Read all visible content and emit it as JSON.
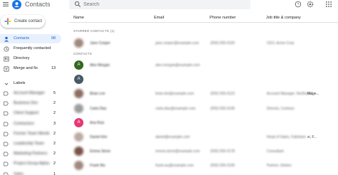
{
  "header": {
    "app_title": "Contacts",
    "search_placeholder": "Search",
    "icons": [
      "menu-icon",
      "contacts-logo-icon",
      "search-icon",
      "help-icon",
      "settings-icon",
      "apps-grid-icon"
    ]
  },
  "sidebar": {
    "create_label": "Create contact",
    "items": [
      {
        "label": "Contacts",
        "count": "98",
        "icon": "person-icon",
        "active": true
      },
      {
        "label": "Frequently contacted",
        "count": "",
        "icon": "history-icon",
        "active": false
      },
      {
        "label": "Directory",
        "count": "",
        "icon": "directory-icon",
        "active": false
      },
      {
        "label": "Merge and fix",
        "count": "13",
        "icon": "merge-icon",
        "active": false
      }
    ],
    "labels_title": "Labels",
    "labels": [
      {
        "name": "Account Manager",
        "count": "5"
      },
      {
        "name": "Business Dev",
        "count": "2"
      },
      {
        "name": "Client Support",
        "count": "2"
      },
      {
        "name": "Contractors",
        "count": "3"
      },
      {
        "name": "Former Team Members",
        "count": "2",
        "suffix": "...2"
      },
      {
        "name": "Leadership Team",
        "count": "2"
      },
      {
        "name": "Marketing Partners",
        "count": "2",
        "suffix": "..."
      },
      {
        "name": "Project Group Alpha",
        "count": "2"
      },
      {
        "name": "Sales",
        "count": "1"
      }
    ]
  },
  "main": {
    "columns": {
      "name": "Name",
      "email": "Email",
      "phone": "Phone number",
      "job": "Job title & company"
    },
    "starred_title": "STARRED CONTACTS (1)",
    "contacts_title": "CONTACTS",
    "starred": [
      {
        "avatar": "",
        "avatar_color": "#a1887f",
        "photo": true,
        "name": "Jane Cooper",
        "email": "jane.cooper@example.com",
        "phone": "(555) 555-0100",
        "job": "CEO, Acme Corp",
        "job_suffix": ""
      }
    ],
    "contacts": [
      {
        "avatar": "A",
        "avatar_color": "#33691e",
        "photo": false,
        "name": "Alex Morgan",
        "email": "alex.morgan@example.com",
        "phone": "",
        "job": "",
        "job_suffix": ""
      },
      {
        "avatar": "A",
        "avatar_color": "#455a64",
        "photo": false,
        "name": "",
        "email": "",
        "phone": "",
        "job": "",
        "job_suffix": ""
      },
      {
        "avatar": "",
        "avatar_color": "#8d6e63",
        "photo": true,
        "name": "Brian Lee",
        "email": "brian.lee@example.com",
        "phone": "(555) 555-0123",
        "job": "Account Manager, Northwind",
        "job_suffix": "Mage..."
      },
      {
        "avatar": "",
        "avatar_color": "#9e9e9e",
        "photo": true,
        "name": "Carla Diaz",
        "email": "carla.diaz@example.com",
        "phone": "(555) 555-0145",
        "job": "Director, Contoso",
        "job_suffix": ""
      },
      {
        "avatar": "A",
        "avatar_color": "#e53877",
        "photo": false,
        "name": "Ana Ruiz",
        "email": "",
        "phone": "",
        "job": "",
        "job_suffix": ""
      },
      {
        "avatar": "",
        "avatar_color": "#bcaaa4",
        "photo": true,
        "name": "Daniel Kim",
        "email": "daniel@example.com",
        "phone": "",
        "job": "Head of Sales, Fabrikam",
        "job_suffix": "si, F..."
      },
      {
        "avatar": "",
        "avatar_color": "#795548",
        "photo": true,
        "name": "Emma Stone",
        "email": "emma.stone@example.com",
        "phone": "(555) 555-0178",
        "job": "Consultant",
        "job_suffix": ""
      },
      {
        "avatar": "",
        "avatar_color": "#a1887f",
        "photo": true,
        "name": "Frank Wu",
        "email": "frank.wu@example.com",
        "phone": "(555) 555-0190",
        "job": "Partner, Globex",
        "job_suffix": ""
      }
    ]
  }
}
